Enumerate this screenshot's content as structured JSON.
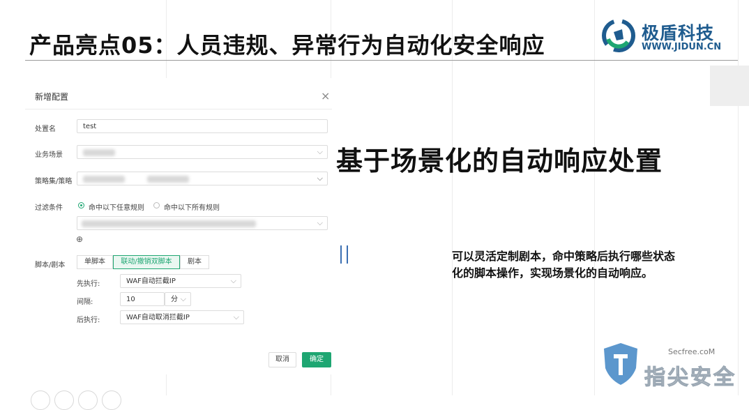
{
  "slide": {
    "title": "产品亮点05：人员违规、异常行为自动化安全响应",
    "heading": "基于场景化的自动响应处置",
    "description_lines": [
      "可以灵活定制剧本，命中策略后执行哪些状态",
      "化的脚本操作，实现场景化的自动响应。"
    ]
  },
  "logo": {
    "name_cn": "极盾科技",
    "url": "WWW.JIDUN.CN",
    "brand_color": "#1f5c8f",
    "accent_color": "#1ea672"
  },
  "dialog": {
    "title": "新增配置",
    "close_icon": "×",
    "fields": {
      "name_label": "处置名",
      "name_value": "test",
      "scene_label": "业务场景",
      "policy_label": "策略集/策略",
      "filter_label": "过滤条件",
      "filter_option_any": "命中以下任意规则",
      "filter_option_all": "命中以下所有规则",
      "add_icon": "⊕",
      "script_label": "脚本/剧本"
    },
    "tabs": [
      "单脚本",
      "联动/撤销双脚本",
      "剧本"
    ],
    "active_tab": "联动/撤销双脚本",
    "first_exec_label": "先执行:",
    "first_exec_value": "WAF自动拦截IP",
    "interval_label": "间隔:",
    "interval_value": "10",
    "interval_unit": "分",
    "then_exec_label": "后执行:",
    "then_exec_value": "WAF自动取消拦截IP",
    "cancel_label": "取消",
    "ok_label": "确定"
  },
  "watermark": {
    "site": "Secfree.coM",
    "name_cn": "指尖安全"
  }
}
